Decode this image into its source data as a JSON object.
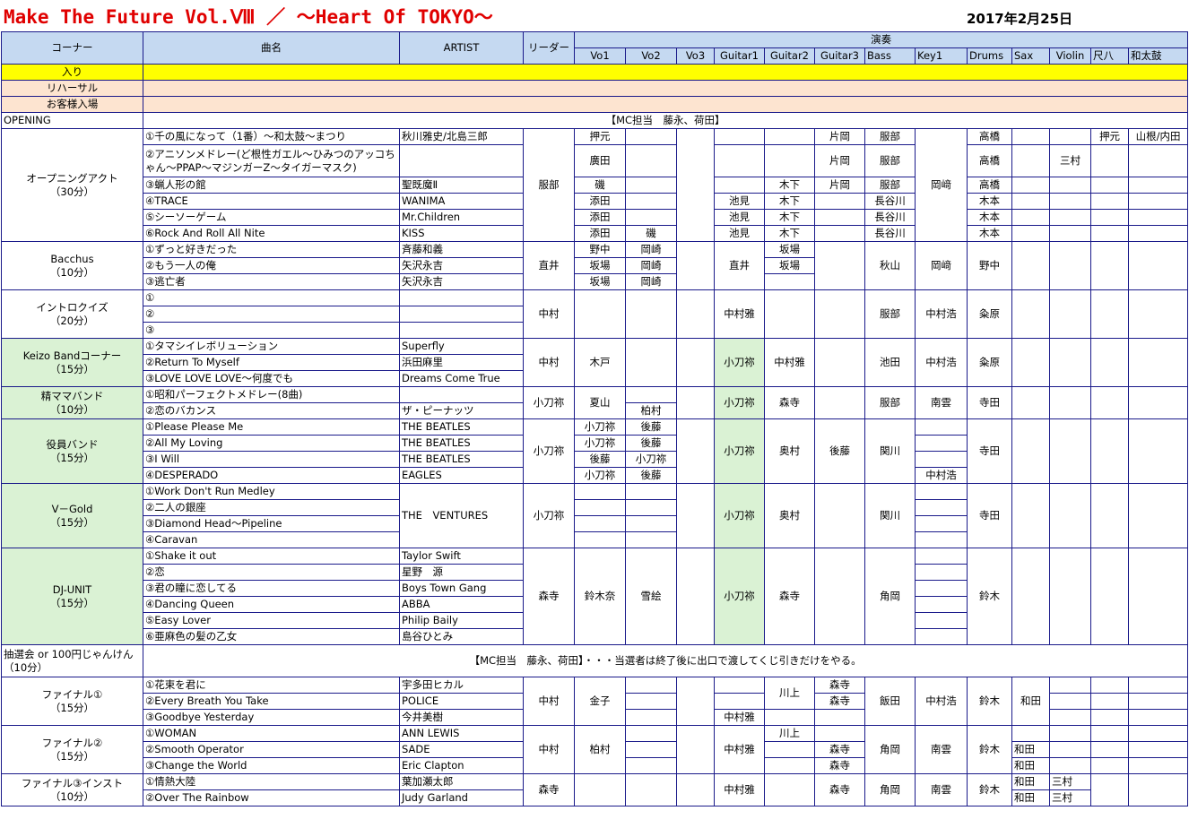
{
  "header": {
    "title": "Make The Future Vol.Ⅷ ／ ～Heart Of TOKYO～",
    "date": "2017年2月25日"
  },
  "columns": {
    "corner": "コーナー",
    "song": "曲名",
    "artist": "ARTIST",
    "leader": "リーダー",
    "ensou": "演奏",
    "parts": [
      "Vo1",
      "Vo2",
      "Vo3",
      "Guitar1",
      "Guitar2",
      "Guitar3",
      "Bass",
      "Key1",
      "Drums",
      "Sax",
      "Violin",
      "尺八",
      "和太鼓"
    ]
  },
  "schedule": {
    "iri": "入り",
    "rehearsal": "リハーサル",
    "entrance": "お客様入場",
    "opening": "OPENING",
    "mc_opening": "【MC担当　藤永、荷田】"
  },
  "opening_act": {
    "corner": "オープニングアクト\n（30分）",
    "leader": "服部",
    "songs": [
      {
        "title": "①千の風になって（1番）～和太鼓～まつり",
        "artist": "秋川雅史/北島三郎"
      },
      {
        "title": "②アニソンメドレー(ど根性ガエル～ひみつのアッコちゃん～PPAP～マジンガーZ～タイガーマスク)",
        "artist": ""
      },
      {
        "title": "③蝋人形の館",
        "artist": "聖既魔Ⅱ"
      },
      {
        "title": "④TRACE",
        "artist": "WANIMA"
      },
      {
        "title": "⑤シーソーゲーム",
        "artist": "Mr.Children"
      },
      {
        "title": "⑥Rock And Roll All Nite",
        "artist": "KISS"
      }
    ],
    "vo1": [
      "押元",
      "廣田",
      "磯",
      "添田",
      "添田",
      "添田"
    ],
    "vo2_6": "磯",
    "guitar1": [
      "池見",
      "池見",
      "池見"
    ],
    "guitar2": [
      "木下",
      "木下",
      "木下",
      "木下"
    ],
    "guitar3": [
      "片岡",
      "片岡",
      "片岡"
    ],
    "bass": [
      "服部",
      "服部",
      "服部",
      "長谷川",
      "長谷川",
      "長谷川"
    ],
    "key1": "岡﨑",
    "drums": [
      "高橋",
      "高橋",
      "高橋",
      "木本",
      "木本",
      "木本"
    ],
    "violin": "三村",
    "shakuhachi": "押元",
    "taiko": "山根/内田"
  },
  "bacchus": {
    "corner": "Bacchus\n（10分）",
    "leader": "直井",
    "songs": [
      {
        "title": "①ずっと好きだった",
        "artist": "斉藤和義"
      },
      {
        "title": "②もう一人の俺",
        "artist": "矢沢永吉"
      },
      {
        "title": "③逃亡者",
        "artist": "矢沢永吉"
      }
    ],
    "vo1": [
      "野中",
      "坂場",
      "坂場"
    ],
    "vo2": [
      "岡崎",
      "岡崎",
      "岡崎"
    ],
    "guitar1": "直井",
    "guitar2": [
      "坂場",
      "坂場"
    ],
    "bass": "秋山",
    "key1": "岡﨑",
    "drums": "野中"
  },
  "intro": {
    "corner": "イントロクイズ\n（20分）",
    "leader": "中村",
    "songs": [
      {
        "title": "①",
        "artist": ""
      },
      {
        "title": "②",
        "artist": ""
      },
      {
        "title": "③",
        "artist": ""
      }
    ],
    "guitar1": "中村雅",
    "bass": "服部",
    "key1": "中村浩",
    "drums": "粂原"
  },
  "keizo": {
    "corner": "Keizo Bandコーナー\n（15分）",
    "leader": "中村",
    "songs": [
      {
        "title": "①タマシイレボリューション",
        "artist": "Superfly"
      },
      {
        "title": "②Return To Myself",
        "artist": "浜田麻里"
      },
      {
        "title": "③LOVE LOVE LOVE～何度でも",
        "artist": "Dreams Come True"
      }
    ],
    "vo1": "木戸",
    "guitar1": "小刀祢",
    "guitar2": "中村雅",
    "bass": "池田",
    "key1": "中村浩",
    "drums": "粂原"
  },
  "seimama": {
    "corner": "精ママバンド\n（10分）",
    "leader": "小刀祢",
    "songs": [
      {
        "title": "①昭和パーフェクトメドレー(8曲)",
        "artist": ""
      },
      {
        "title": "②恋のバカンス",
        "artist": "ザ・ピーナッツ"
      }
    ],
    "vo1": "夏山",
    "vo2": "柏村",
    "guitar1": "小刀祢",
    "guitar2": "森寺",
    "bass": "服部",
    "key1": "南雲",
    "drums": "寺田"
  },
  "yakuin": {
    "corner": "役員バンド\n（15分）",
    "leader": "小刀祢",
    "songs": [
      {
        "title": "①Please Please Me",
        "artist": "THE BEATLES"
      },
      {
        "title": "②All My Loving",
        "artist": "THE BEATLES"
      },
      {
        "title": "③I Will",
        "artist": "THE BEATLES"
      },
      {
        "title": "④DESPERADO",
        "artist": "EAGLES"
      }
    ],
    "vo1": [
      "小刀祢",
      "小刀祢",
      "後藤",
      "小刀祢"
    ],
    "vo2": [
      "後藤",
      "後藤",
      "小刀祢",
      "後藤"
    ],
    "guitar1": "小刀祢",
    "guitar2": "奥村",
    "guitar3": "後藤",
    "bass": "関川",
    "key1_4": "中村浩",
    "drums": "寺田"
  },
  "vgold": {
    "corner": "V－Gold\n（15分）",
    "leader": "小刀祢",
    "songs": [
      {
        "title": "①Work Don't Run Medley"
      },
      {
        "title": "②二人の銀座"
      },
      {
        "title": "③Diamond Head～Pipeline"
      },
      {
        "title": "④Caravan"
      }
    ],
    "artist": "THE　VENTURES",
    "guitar1": "小刀祢",
    "guitar2": "奥村",
    "bass": "関川",
    "drums": "寺田"
  },
  "dj": {
    "corner": "DJ-UNIT\n（15分）",
    "leader": "森寺",
    "songs": [
      {
        "title": "①Shake it out",
        "artist": "Taylor Swift"
      },
      {
        "title": "②恋",
        "artist": "星野　源"
      },
      {
        "title": "③君の瞳に恋してる",
        "artist": "Boys Town Gang"
      },
      {
        "title": "④Dancing Queen",
        "artist": "ABBA"
      },
      {
        "title": "⑤Easy Lover",
        "artist": "Philip Baily"
      },
      {
        "title": "⑥亜麻色の髪の乙女",
        "artist": "島谷ひとみ"
      }
    ],
    "vo1": "鈴木奈",
    "vo2": "雪絵",
    "guitar1": "小刀祢",
    "guitar2": "森寺",
    "bass": "角岡",
    "drums": "鈴木"
  },
  "lottery": {
    "corner": "抽選会 or 100円じゃんけん（10分）",
    "note": "【MC担当　藤永、荷田】・・・当選者は終了後に出口で渡してくじ引きだけをやる。"
  },
  "final1": {
    "corner": "ファイナル①\n（15分）",
    "leader": "中村",
    "songs": [
      {
        "title": "①花束を君に",
        "artist": "宇多田ヒカル"
      },
      {
        "title": "②Every Breath You Take",
        "artist": "POLICE"
      },
      {
        "title": "③Goodbye Yesterday",
        "artist": "今井美樹"
      }
    ],
    "vo1": "金子",
    "guitar1_3": "中村雅",
    "guitar2": "川上",
    "guitar3": [
      "森寺",
      "森寺"
    ],
    "bass": "飯田",
    "key1": "中村浩",
    "drums": "鈴木",
    "sax": "和田"
  },
  "final2": {
    "corner": "ファイナル②\n（15分）",
    "leader": "中村",
    "songs": [
      {
        "title": "①WOMAN",
        "artist": "ANN LEWIS"
      },
      {
        "title": "②Smooth Operator",
        "artist": "SADE"
      },
      {
        "title": "③Change the World",
        "artist": "Eric Clapton"
      }
    ],
    "vo1": "柏村",
    "guitar1": "中村雅",
    "guitar2_1": "川上",
    "guitar3": [
      "森寺",
      "森寺"
    ],
    "bass": "角岡",
    "key1": "南雲",
    "drums": "鈴木",
    "sax": [
      "和田",
      "和田"
    ]
  },
  "final3": {
    "corner": "ファイナル③インスト\n（10分）",
    "leader": "森寺",
    "songs": [
      {
        "title": "①情熱大陸",
        "artist": "葉加瀬太郎"
      },
      {
        "title": "②Over The Rainbow",
        "artist": "Judy Garland"
      }
    ],
    "guitar1": "中村雅",
    "guitar3": "森寺",
    "bass": "角岡",
    "key1": "南雲",
    "drums": "鈴木",
    "sax": [
      "和田",
      "和田"
    ],
    "violin": [
      "三村",
      "三村"
    ]
  }
}
